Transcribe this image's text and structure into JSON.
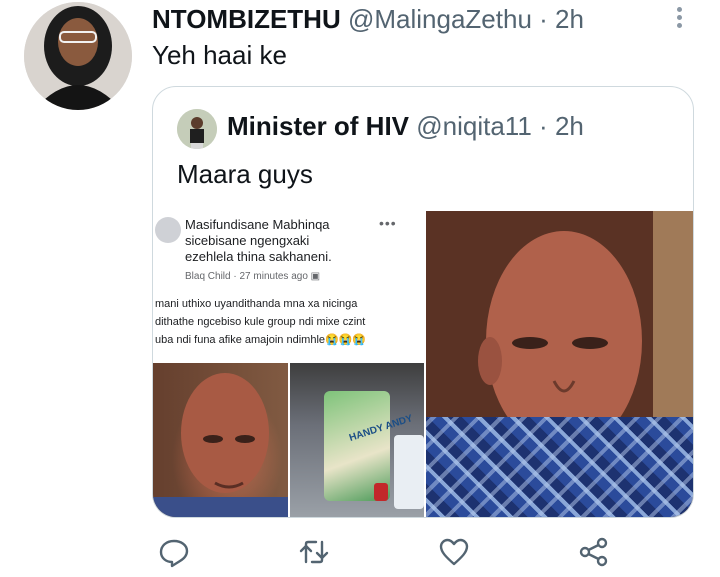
{
  "tweet": {
    "display_name": "NTOMBIZETHU",
    "handle": "@MalingaZethu",
    "separator": "·",
    "time": "2h",
    "text": "Yeh haai ke"
  },
  "quoted_tweet": {
    "display_name": "Minister of HIV",
    "handle": "@niqita11",
    "separator": "·",
    "time": "2h",
    "text": "Maara guys"
  },
  "fb_post": {
    "name_line1": "Masifundisane Mabhinqa",
    "name_line2": "sicebisane ngengxaki",
    "name_line3": "ezehlela thina sakhaneni.",
    "author": "Blaq Child",
    "dot": "·",
    "time": "27 minutes ago",
    "dots": "•••",
    "body_line1": "mani uthixo uyandithanda mna xa nicinga",
    "body_line2": "dithathe ngcebiso kule group ndi mixe czint",
    "body_line3": "uba ndi funa afike amajoin ndimhle😭😭😭",
    "product_label": "HANDY ANDY"
  },
  "actions": {
    "icons": [
      "reply-icon",
      "retweet-icon",
      "like-icon",
      "share-icon"
    ]
  }
}
